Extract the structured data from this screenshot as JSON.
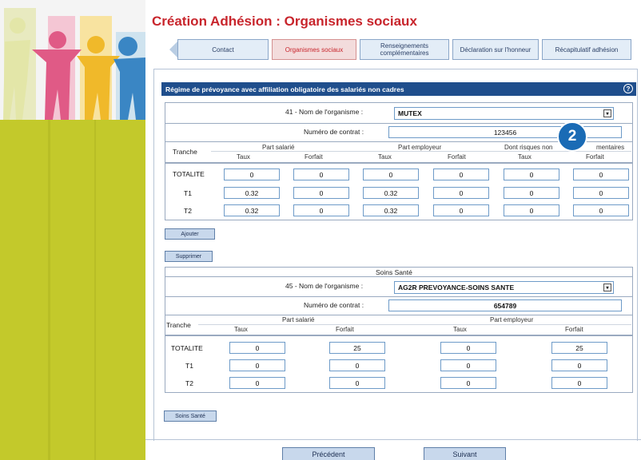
{
  "colors": {
    "title": "#c8252c",
    "header": "#1f4e8c",
    "left_panel": "#c3c92b",
    "badge": "#1a6bb5"
  },
  "page": {
    "title": "Création Adhésion : Organismes sociaux"
  },
  "tabs": [
    {
      "label": "Contact",
      "active": false
    },
    {
      "label": "Organismes sociaux",
      "active": true
    },
    {
      "label": "Renseignements complémentaires",
      "active": false
    },
    {
      "label": "Déclaration sur l'honneur",
      "active": false
    },
    {
      "label": "Récapitulatif adhésion",
      "active": false
    }
  ],
  "section": {
    "title": "Régime de prévoyance avec affiliation obligatoire des salariés non cadres",
    "help_icon": "question-circle-icon",
    "help_glyph": "?"
  },
  "prevoyance": {
    "organisme_label": "41 - Nom de l'organisme :",
    "organisme_value": "MUTEX",
    "contrat_label": "Numéro de contrat :",
    "contrat_value": "123456",
    "tranche_header": "Tranche",
    "groups": [
      "Part salarié",
      "Part employeur",
      "Dont risques non",
      "mentaires"
    ],
    "subheaders": [
      "Taux",
      "Forfait",
      "Taux",
      "Forfait",
      "Taux",
      "Forfait"
    ],
    "rows": [
      {
        "label": "TOTALITE",
        "values": [
          "0",
          "0",
          "0",
          "0",
          "0",
          "0"
        ]
      },
      {
        "label": "T1",
        "values": [
          "0.32",
          "0",
          "0.32",
          "0",
          "0",
          "0"
        ]
      },
      {
        "label": "T2",
        "values": [
          "0.32",
          "0",
          "0.32",
          "0",
          "0",
          "0"
        ]
      }
    ]
  },
  "buttons": {
    "ajouter": "Ajouter",
    "supprimer": "Supprimer",
    "soins_sante": "Soins Santé",
    "precedent": "Précédent",
    "suivant": "Suivant"
  },
  "sante": {
    "title": "Soins Santé",
    "organisme_label": "45 - Nom de l'organisme :",
    "organisme_value": "AG2R PREVOYANCE-SOINS SANTE",
    "contrat_label": "Numéro de contrat :",
    "contrat_value": "654789",
    "tranche_header": "Tranche",
    "groups": [
      "Part salarié",
      "Part employeur"
    ],
    "subheaders": [
      "Taux",
      "Forfait",
      "Taux",
      "Forfait"
    ],
    "rows": [
      {
        "label": "TOTALITE",
        "values": [
          "0",
          "25",
          "0",
          "25"
        ]
      },
      {
        "label": "T1",
        "values": [
          "0",
          "0",
          "0",
          "0"
        ]
      },
      {
        "label": "T2",
        "values": [
          "0",
          "0",
          "0",
          "0"
        ]
      }
    ]
  },
  "callout": {
    "number": "2"
  },
  "dropdown_glyph": "▾"
}
